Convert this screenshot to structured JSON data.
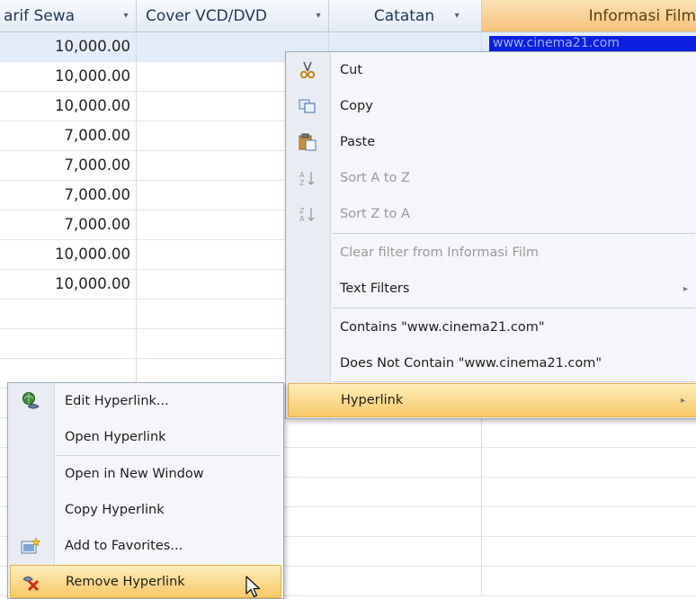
{
  "columns": {
    "tarif_sewa": "arif Sewa",
    "cover": "Cover VCD/DVD",
    "catatan": "Catatan",
    "informasi_film": "Informasi Film",
    "dropdown_glyph": "▾"
  },
  "rows": [
    "10,000.00",
    "10,000.00",
    "10,000.00",
    "7,000.00",
    "7,000.00",
    "7,000.00",
    "7,000.00",
    "10,000.00",
    "10,000.00",
    "",
    ""
  ],
  "selected_link_text": "www.cinema21.com",
  "context_menu": {
    "cut": "Cut",
    "copy": "Copy",
    "paste": "Paste",
    "sort_az": "Sort A to Z",
    "sort_za": "Sort Z to A",
    "clear_filter": "Clear filter from Informasi Film",
    "text_filters": "Text Filters",
    "contains": "Contains \"www.cinema21.com\"",
    "does_not_contain": "Does Not Contain \"www.cinema21.com\"",
    "hyperlink": "Hyperlink",
    "submenu_arrow": "▸"
  },
  "hyperlink_submenu": {
    "edit": "Edit Hyperlink...",
    "open": "Open Hyperlink",
    "open_new_window": "Open in New Window",
    "copy": "Copy Hyperlink",
    "add_favorites": "Add to Favorites...",
    "remove": "Remove Hyperlink"
  },
  "colors": {
    "highlight": "#f7c867",
    "selected_cell": "#0a1fe0",
    "header": "#e4ebf5",
    "active_header": "#f6c27a"
  },
  "icons": [
    "scissors-icon",
    "copy-icon",
    "paste-icon",
    "sort-ascending-icon",
    "sort-descending-icon",
    "edit-hyperlink-icon",
    "add-favorites-icon",
    "remove-hyperlink-icon",
    "mouse-cursor-icon"
  ]
}
